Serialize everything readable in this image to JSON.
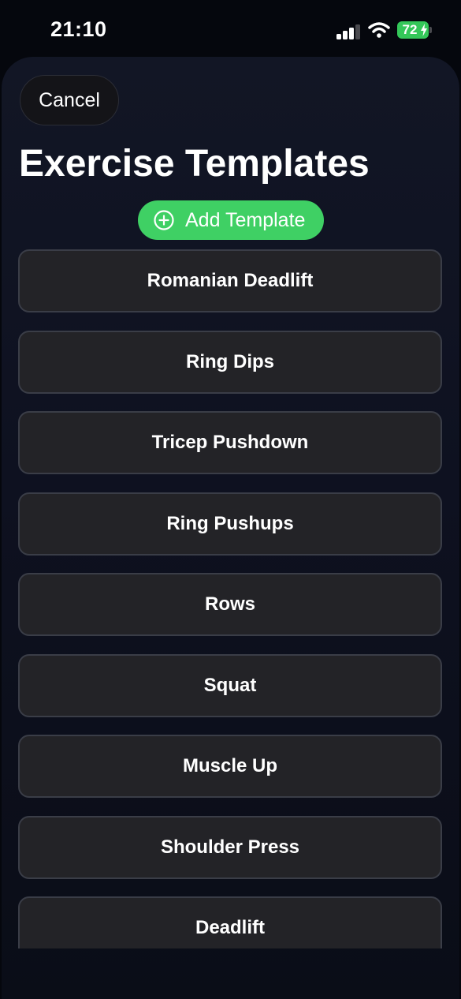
{
  "status_bar": {
    "time": "21:10",
    "battery": "72"
  },
  "sheet": {
    "cancel_label": "Cancel",
    "title": "Exercise Templates",
    "add_template_label": "Add Template"
  },
  "templates": [
    "Romanian Deadlift",
    "Ring Dips",
    "Tricep Pushdown",
    "Ring Pushups",
    "Rows",
    "Squat",
    "Muscle Up",
    "Shoulder Press",
    "Deadlift"
  ],
  "colors": {
    "accent_green": "#3fd064",
    "battery_green": "#34c759",
    "row_background": "#232327",
    "row_border": "#3a3d47",
    "sheet_background": "#121625"
  },
  "icons": {
    "signal": "cellular-signal-icon",
    "wifi": "wifi-icon",
    "battery": "battery-icon",
    "charging": "charging-bolt-icon",
    "add": "plus-circle-icon"
  }
}
